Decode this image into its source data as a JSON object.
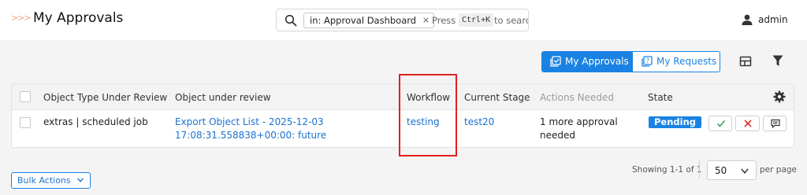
{
  "header": {
    "breadcrumb_glyph": ">>>",
    "title": "My Approvals",
    "search": {
      "scope_chip": "in: Approval Dashboard",
      "chip_close": "×",
      "hint_press": "Press",
      "hint_kbd": "Ctrl+K",
      "hint_suffix": "to search"
    },
    "user": {
      "name": "admin"
    }
  },
  "view_toggle": {
    "active_label": "My Approvals",
    "inactive_label": "My Requests"
  },
  "table": {
    "columns": [
      "Object Type Under Review",
      "Object under review",
      "Workflow",
      "Current Stage",
      "Actions Needed",
      "State"
    ],
    "rows": [
      {
        "object_type": "extras | scheduled job",
        "object_line1": "Export Object List - 2025-12-03",
        "object_line2": "17:08:31.558838+00:00: future",
        "workflow": "testing",
        "current_stage": "test20",
        "actions_line1": "1 more approval",
        "actions_line2": "needed",
        "state": "Pending"
      }
    ]
  },
  "footer": {
    "bulk_actions_label": "Bulk Actions",
    "showing_text": "Showing 1-1 of 1",
    "page_size": "50",
    "per_page_label": "per page"
  },
  "colors": {
    "accent": "#1a82e2",
    "link": "#1a72d0",
    "highlight": "#e02020",
    "approve": "#2e9e4f",
    "deny": "#d9342b"
  },
  "icons": [
    "search-icon",
    "close-icon",
    "user-icon",
    "approvals-icon",
    "requests-icon",
    "layout-icon",
    "filter-icon",
    "gear-icon",
    "check-icon",
    "x-icon",
    "comment-icon",
    "chevron-down-icon"
  ]
}
